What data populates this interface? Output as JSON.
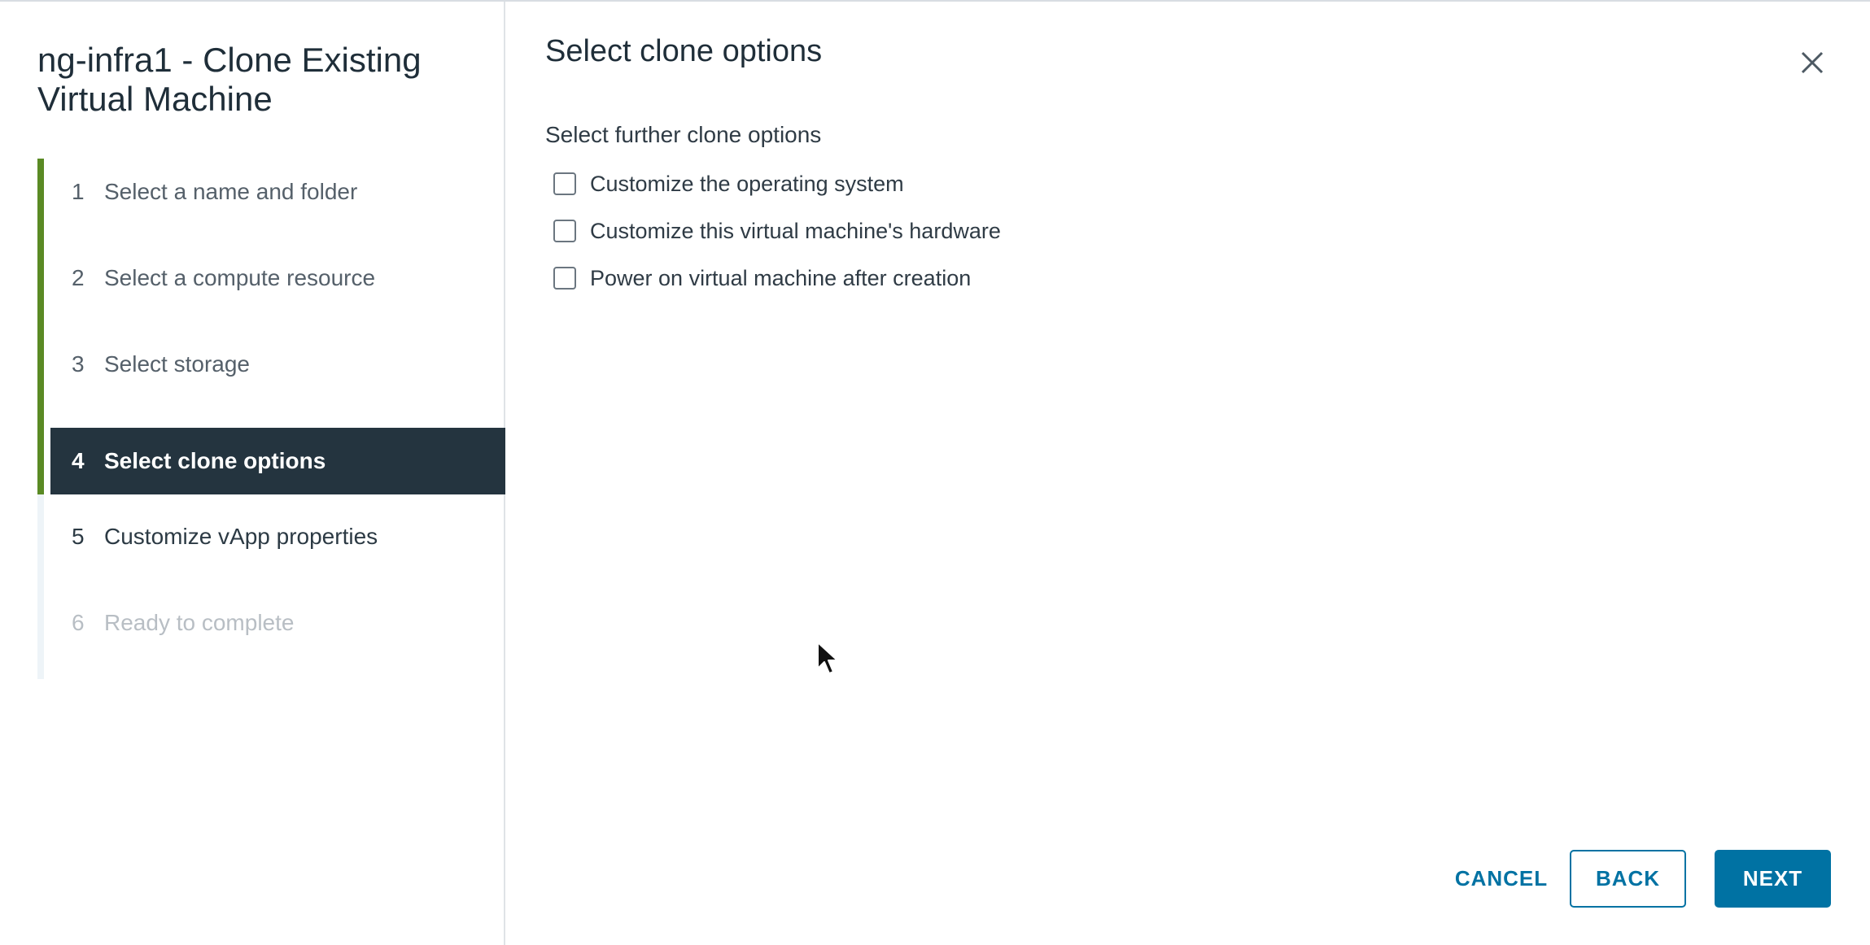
{
  "wizard": {
    "title": "ng-infra1 - Clone Existing Virtual Machine",
    "steps": [
      {
        "number": "1",
        "label": "Select a name and folder",
        "state": "completed"
      },
      {
        "number": "2",
        "label": "Select a compute resource",
        "state": "completed"
      },
      {
        "number": "3",
        "label": "Select storage",
        "state": "completed"
      },
      {
        "number": "4",
        "label": "Select clone options",
        "state": "active"
      },
      {
        "number": "5",
        "label": "Customize vApp properties",
        "state": "upcoming"
      },
      {
        "number": "6",
        "label": "Ready to complete",
        "state": "disabled"
      }
    ]
  },
  "page": {
    "title": "Select clone options",
    "section_label": "Select further clone options",
    "options": [
      {
        "label": "Customize the operating system",
        "checked": false
      },
      {
        "label": "Customize this virtual machine's hardware",
        "checked": false
      },
      {
        "label": "Power on virtual machine after creation",
        "checked": false
      }
    ]
  },
  "footer": {
    "cancel_label": "CANCEL",
    "back_label": "BACK",
    "next_label": "NEXT"
  },
  "icons": {
    "close": "close-icon",
    "cursor": "mouse-pointer-icon"
  },
  "colors": {
    "progress_bar": "#5a8a24",
    "active_step_bg": "#24343f",
    "primary_button": "#0072a3"
  }
}
